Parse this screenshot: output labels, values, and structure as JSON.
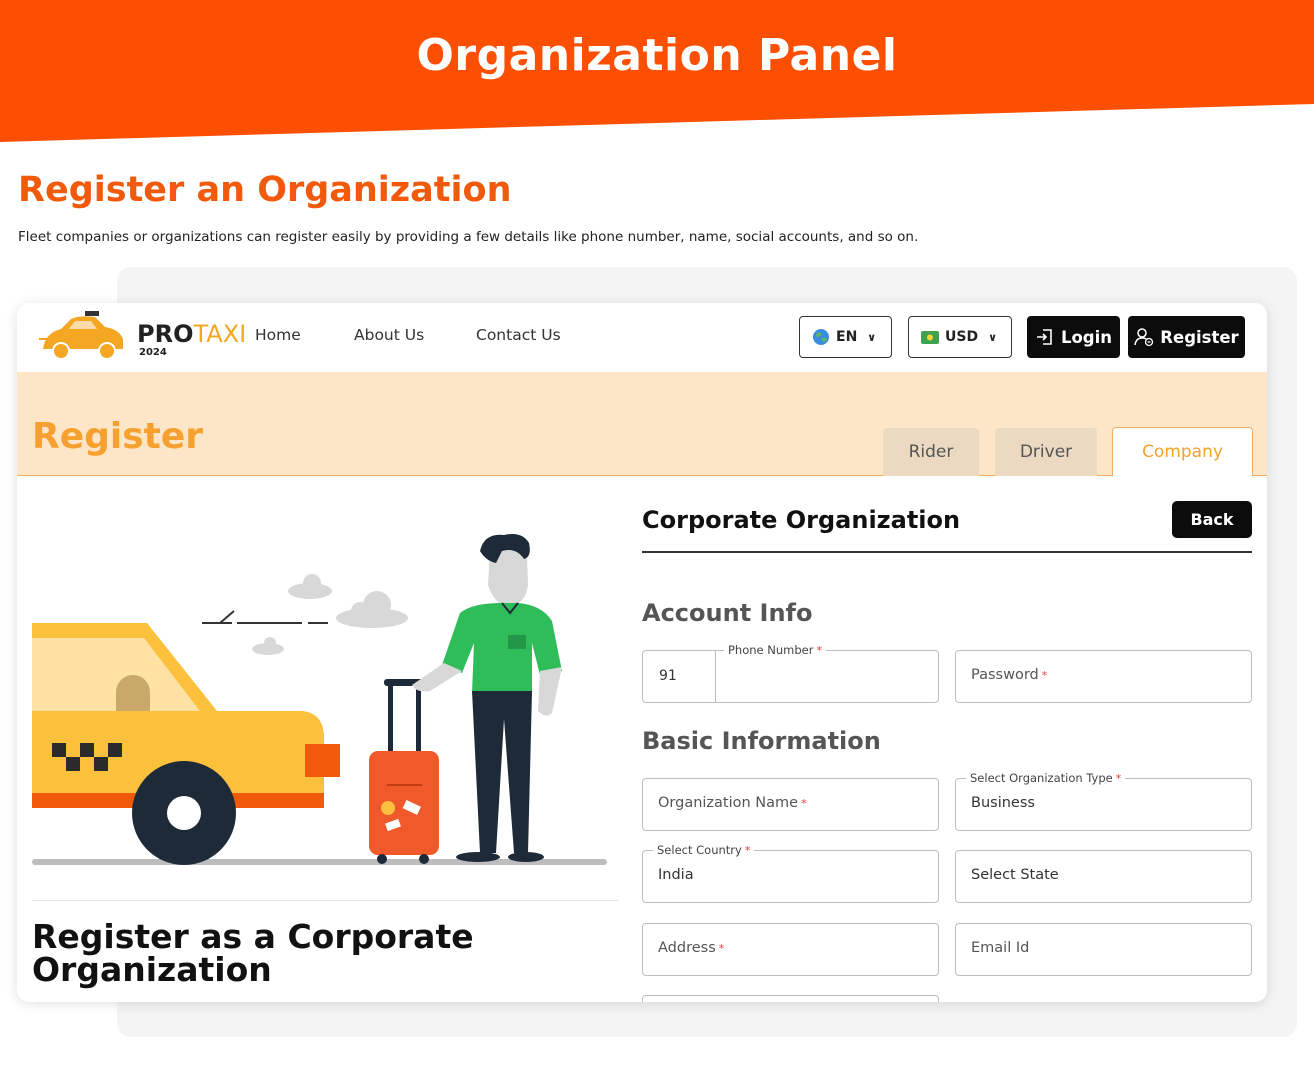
{
  "banner": {
    "title": "Organization Panel",
    "color": "#fc4f02"
  },
  "section": {
    "title": "Register an Organization",
    "description": "Fleet companies or organizations can register easily by providing a few details like phone number, name, social accounts, and so on."
  },
  "nav": {
    "logo_pro": "PRO",
    "logo_taxi": "TAXI",
    "logo_year": "2024",
    "links": [
      "Home",
      "About Us",
      "Contact Us"
    ],
    "language": "EN",
    "currency": "USD",
    "login_label": "Login",
    "register_label": "Register"
  },
  "register": {
    "title": "Register",
    "tabs": [
      {
        "label": "Rider",
        "active": false
      },
      {
        "label": "Driver",
        "active": false
      },
      {
        "label": "Company",
        "active": true
      }
    ]
  },
  "left": {
    "title": "Register as a Corporate Organization"
  },
  "form": {
    "title": "Corporate Organization",
    "back_label": "Back",
    "account_info_title": "Account Info",
    "basic_info_title": "Basic Information",
    "phone": {
      "label": "Phone Number",
      "code": "91",
      "value": ""
    },
    "password": {
      "placeholder": "Password"
    },
    "org_name": {
      "placeholder": "Organization Name"
    },
    "org_type": {
      "label": "Select Organization Type",
      "value": "Business"
    },
    "country": {
      "label": "Select Country",
      "value": "India"
    },
    "state": {
      "placeholder": "Select State"
    },
    "address": {
      "placeholder": "Address"
    },
    "email": {
      "placeholder": "Email Id"
    },
    "required_mark": "*"
  },
  "colors": {
    "accent": "#f05a0a",
    "register_band": "#fde6c7",
    "register_text": "#f5a02f"
  }
}
